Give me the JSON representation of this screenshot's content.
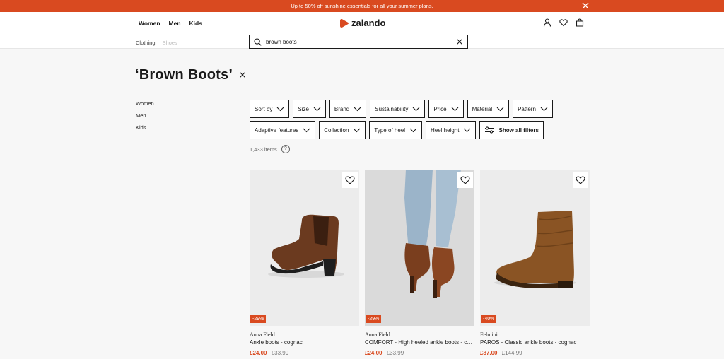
{
  "banner": {
    "text": "Up to 50% off sunshine essentials for all your summer plans.",
    "close_icon": "close-icon"
  },
  "header": {
    "genders": [
      "Women",
      "Men",
      "Kids"
    ],
    "sub_nav": [
      "Clothing",
      "Shoes"
    ],
    "logo_text": "zalando",
    "icons": [
      "account-icon",
      "wishlist-icon",
      "bag-icon"
    ]
  },
  "search": {
    "value": "brown boots",
    "placeholder": "Search"
  },
  "page": {
    "title": "‘Brown Boots’"
  },
  "categories": [
    "Women",
    "Men",
    "Kids"
  ],
  "filters": {
    "row1": [
      "Sort by",
      "Size",
      "Brand",
      "Sustainability",
      "Price",
      "Material",
      "Pattern"
    ],
    "row2": [
      "Adaptive features",
      "Collection",
      "Type of heel",
      "Heel height"
    ],
    "show_all": "Show all filters"
  },
  "results": {
    "count": "1,433 items",
    "help": "?"
  },
  "products": [
    {
      "brand": "Anna Field",
      "name": "Ankle boots - cognac",
      "price": "£24.00",
      "old_price": "£33.99",
      "discount": "-29%"
    },
    {
      "brand": "Anna Field",
      "name": "COMFORT - High heeled ankle boots - cognac",
      "price": "£24.00",
      "old_price": "£33.99",
      "discount": "-29%"
    },
    {
      "brand": "Felmini",
      "name": "PAROS - Classic ankle boots - cognac",
      "price": "£87.00",
      "old_price": "£144.99",
      "discount": "-40%"
    }
  ],
  "colors": {
    "accent": "#d94a20",
    "text": "#1a1a1a",
    "boot_brown": "#6b3a1f",
    "boot_suede": "#8a5424"
  }
}
